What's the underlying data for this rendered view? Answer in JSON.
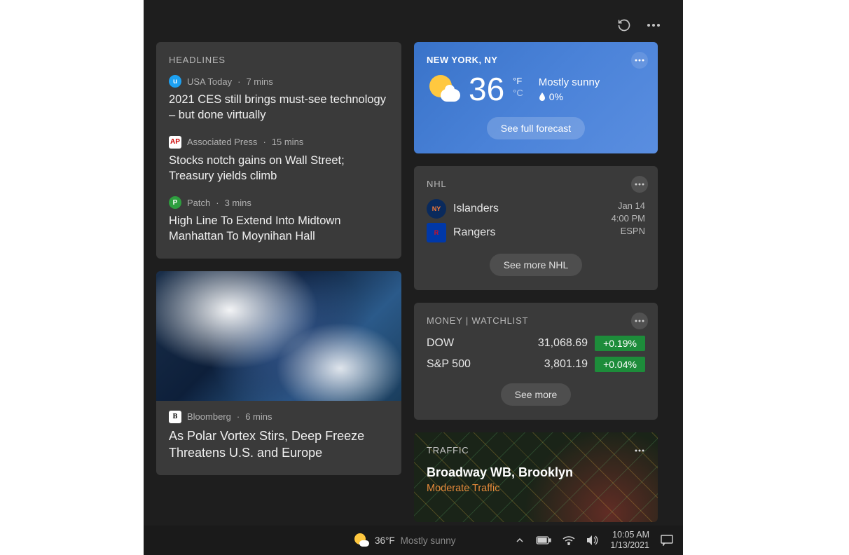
{
  "header": {},
  "headlines": {
    "title": "HEADLINES",
    "items": [
      {
        "source": "USA Today",
        "time": "7 mins",
        "logo_bg": "#1da1f2",
        "logo_fg": "#fff",
        "logo_text": "u",
        "title": "2021 CES still brings must-see technology – but done virtually"
      },
      {
        "source": "Associated Press",
        "time": "15 mins",
        "logo_bg": "#fff",
        "logo_fg": "#c00",
        "logo_text": "AP",
        "title": "Stocks notch gains on Wall Street; Treasury yields climb"
      },
      {
        "source": "Patch",
        "time": "3 mins",
        "logo_bg": "#2e9e3f",
        "logo_fg": "#fff",
        "logo_text": "P",
        "title": "High Line To Extend Into Midtown Manhattan To Moynihan Hall"
      }
    ]
  },
  "image_article": {
    "source": "Bloomberg",
    "time": "6 mins",
    "logo_bg": "#fff",
    "logo_fg": "#000",
    "logo_text": "B",
    "title": "As Polar Vortex Stirs, Deep Freeze Threatens U.S. and Europe"
  },
  "weather": {
    "location": "NEW YORK, NY",
    "temp": "36",
    "unit_f": "°F",
    "unit_c": "°C",
    "condition": "Mostly sunny",
    "precip": "0%",
    "forecast_btn": "See full forecast"
  },
  "nhl": {
    "title": "NHL",
    "team1": "Islanders",
    "team2": "Rangers",
    "date": "Jan 14",
    "time": "4:00 PM",
    "network": "ESPN",
    "more_btn": "See more NHL"
  },
  "money": {
    "title": "MONEY | WATCHLIST",
    "rows": [
      {
        "name": "DOW",
        "value": "31,068.69",
        "change": "+0.19%"
      },
      {
        "name": "S&P 500",
        "value": "3,801.19",
        "change": "+0.04%"
      }
    ],
    "more_btn": "See more"
  },
  "traffic": {
    "title": "TRAFFIC",
    "location": "Broadway WB, Brooklyn",
    "status": "Moderate Traffic"
  },
  "taskbar": {
    "temp": "36°F",
    "condition": "Mostly sunny",
    "time": "10:05 AM",
    "date": "1/13/2021"
  }
}
